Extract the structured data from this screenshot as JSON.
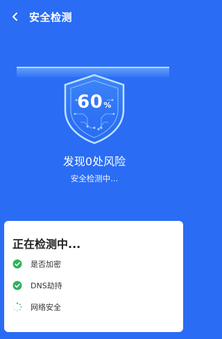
{
  "header": {
    "title": "安全检测"
  },
  "scan": {
    "percent_value": "60",
    "percent_symbol": "%"
  },
  "risk": {
    "title": "发现0处风险",
    "subtitle": "安全检测中..."
  },
  "card": {
    "title": "正在检测中...",
    "items": [
      {
        "label": "是否加密",
        "status": "done",
        "icon": "check-circle-icon"
      },
      {
        "label": "DNS劫持",
        "status": "done",
        "icon": "check-circle-icon"
      },
      {
        "label": "网络安全",
        "status": "loading",
        "icon": "loading-spinner-icon"
      }
    ]
  },
  "colors": {
    "background": "#2a6cf4",
    "check": "#2fb35a",
    "spinner": "#2fb35a"
  }
}
